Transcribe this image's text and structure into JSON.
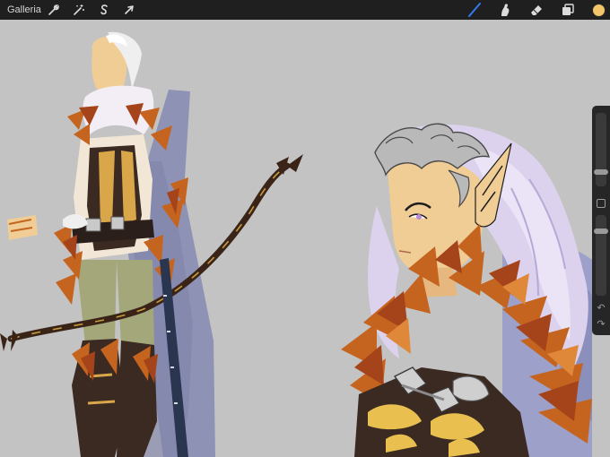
{
  "toolbar": {
    "gallery_label": "Galleria",
    "actions_icon": "wrench-icon",
    "adjustments_icon": "magic-wand-icon",
    "selection_icon": "selection-s-icon",
    "transform_icon": "arrow-cursor-icon",
    "brush_icon": "brush-icon",
    "smudge_icon": "smudge-finger-icon",
    "eraser_icon": "eraser-icon",
    "layers_icon": "layers-icon",
    "active_color": "#f2c56b",
    "active_tool_color": "#2f7bf5"
  },
  "sidebar": {
    "brush_size": 0.2,
    "opacity": 0.8,
    "undo_icon": "undo-arrow-icon",
    "redo_icon": "redo-arrow-icon"
  },
  "canvas": {
    "background_color": "#c3c3c3"
  }
}
